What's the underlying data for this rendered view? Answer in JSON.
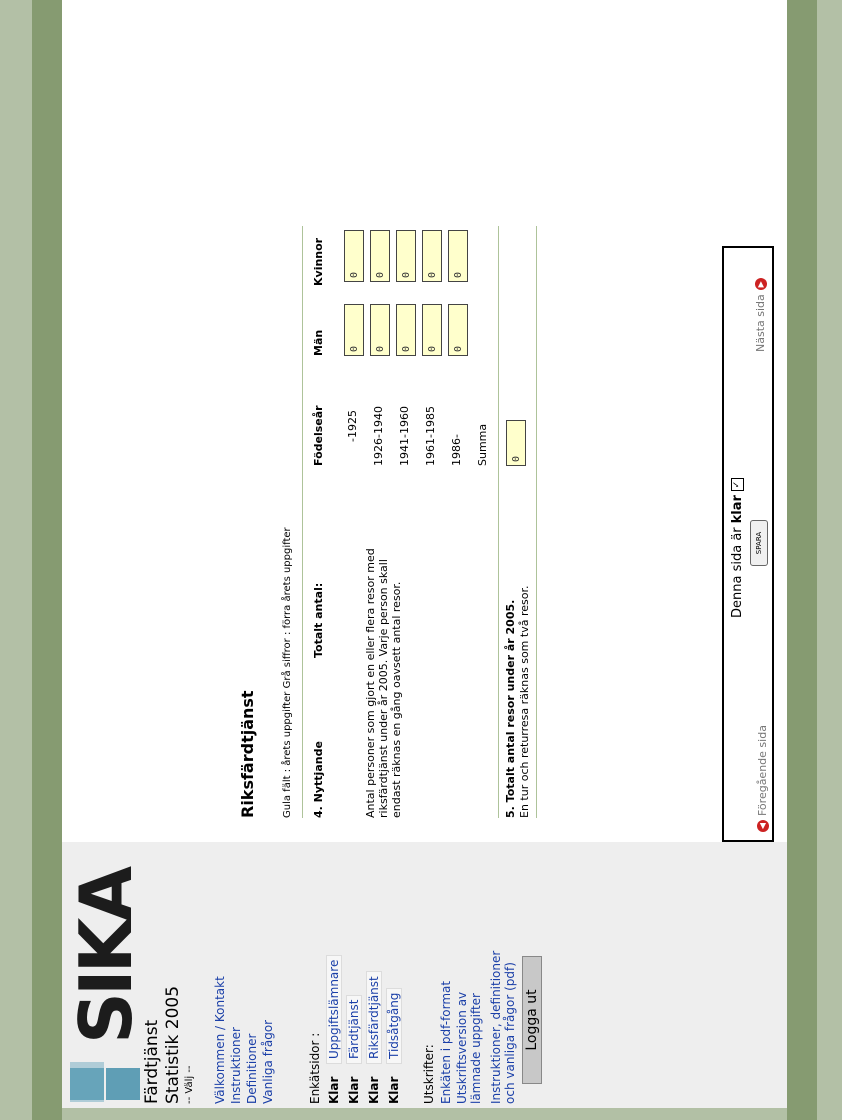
{
  "sidebar": {
    "brand": "SIKA",
    "app_title_line1": "Färdtjänst",
    "app_title_line2": "Statistik 2005",
    "choose": "-- Välj --",
    "links": [
      "Välkommen / Kontakt",
      "Instruktioner",
      "Definitioner",
      "Vanliga frågor"
    ],
    "survey_label": "Enkätsidor :",
    "survey_items": [
      {
        "status": "Klar",
        "label": "Uppgiftslämnare"
      },
      {
        "status": "Klar",
        "label": "Färdtjänst"
      },
      {
        "status": "Klar",
        "label": "Riksfärdtjänst"
      },
      {
        "status": "Klar",
        "label": "Tidsåtgång"
      }
    ],
    "print_label": "Utskrifter:",
    "print_links": [
      "Enkäten i pdf-format",
      "Utskriftsversion av",
      "lämnade uppgifter"
    ],
    "pdf_link_line1": "Instruktioner, definitioner",
    "pdf_link_line2": "och vanliga frågor (pdf)",
    "logout": "Logga ut"
  },
  "main": {
    "title": "Riksfärdtjänst",
    "legend": "Gula fält : årets uppgifter  Grå siffror : förra årets uppgifter",
    "q4": {
      "head": "4. Nyttjande",
      "total_head": "Totalt antal:",
      "text": "Antal personer som gjort en eller flera resor med riksfärdtjänst under år 2005. Varje person skall endast räknas en gång oavsett antal resor.",
      "col_birth": "Födelseår",
      "col_men": "Män",
      "col_women": "Kvinnor",
      "rows": [
        {
          "label": "-1925",
          "men": "0",
          "women": "0"
        },
        {
          "label": "1926-1940",
          "men": "0",
          "women": "0"
        },
        {
          "label": "1941-1960",
          "men": "0",
          "women": "0"
        },
        {
          "label": "1961-1985",
          "men": "0",
          "women": "0"
        },
        {
          "label": "1986-",
          "men": "0",
          "women": "0"
        }
      ],
      "sum_label": "Summa"
    },
    "q5": {
      "head": "5. Totalt antal resor under år 2005.",
      "text": "En tur och returresa räknas som två resor.",
      "value": "0"
    }
  },
  "footer": {
    "prev": "Föregående sida",
    "next": "Nästa sida",
    "status_prefix": "Denna sida är",
    "status_value": "klar",
    "save": "SPARA"
  }
}
